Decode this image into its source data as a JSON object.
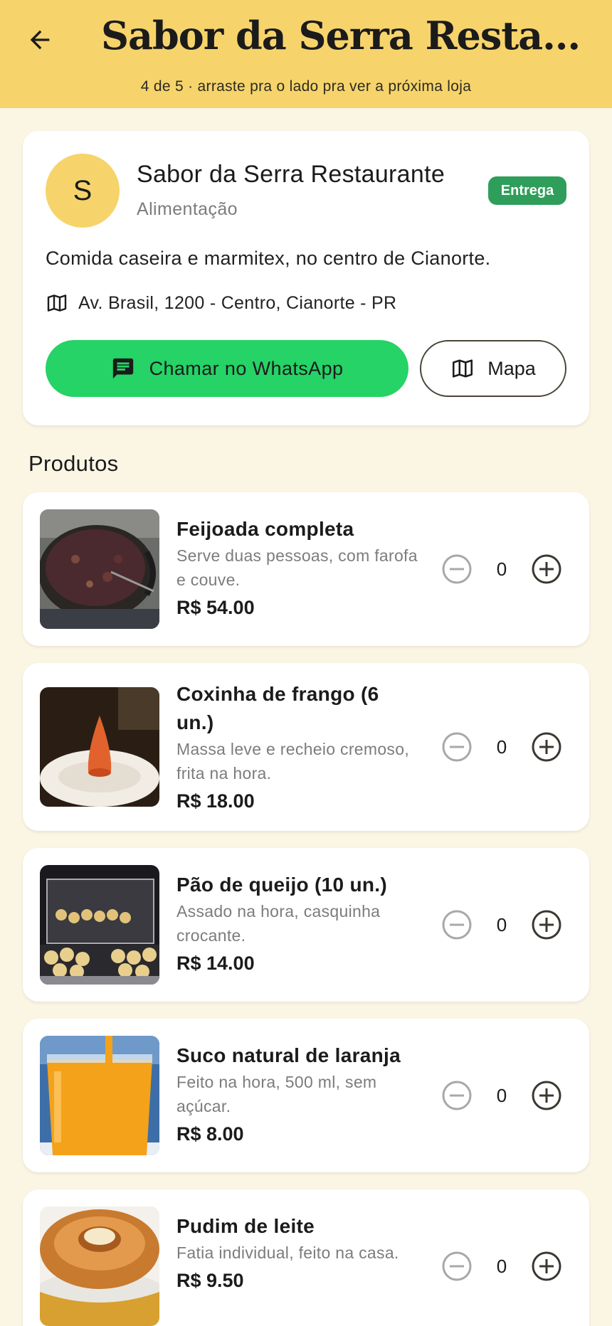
{
  "header": {
    "title": "Sabor da Serra Restaur…",
    "subtitle": "4 de 5 · arraste pra o lado pra ver a próxima loja",
    "back_icon": "arrow-left-icon"
  },
  "store": {
    "avatar_letter": "S",
    "name": "Sabor da Serra Restaurante",
    "category": "Alimentação",
    "badge": "Entrega",
    "description": "Comida caseira e marmitex, no centro de Cianorte.",
    "address": "Av. Brasil, 1200 - Centro, Cianorte - PR",
    "whatsapp_label": "Chamar no WhatsApp",
    "map_label": "Mapa"
  },
  "products_title": "Produtos",
  "products": [
    {
      "name": "Feijoada completa",
      "description": "Serve duas pessoas, com farofa e couve.",
      "price": "R$ 54.00",
      "quantity": "0",
      "image": "feijoada-pot"
    },
    {
      "name": "Coxinha de frango (6 un.)",
      "description": "Massa leve e recheio cremoso, frita na hora.",
      "price": "R$ 18.00",
      "quantity": "0",
      "image": "coxinha-plate"
    },
    {
      "name": "Pão de queijo (10 un.)",
      "description": "Assado na hora, casquinha crocante.",
      "price": "R$ 14.00",
      "quantity": "0",
      "image": "pao-de-queijo-trays"
    },
    {
      "name": "Suco natural de laranja",
      "description": "Feito na hora, 500 ml, sem açúcar.",
      "price": "R$ 8.00",
      "quantity": "0",
      "image": "orange-juice-glass"
    },
    {
      "name": "Pudim de leite",
      "description": "Fatia individual, feito na casa.",
      "price": "R$ 9.50",
      "quantity": "0",
      "image": "pudim-dish"
    }
  ],
  "colors": {
    "header_bg": "#f6d46b",
    "page_bg": "#fbf5e4",
    "badge_bg": "#2e9e5a",
    "whatsapp_bg": "#25d366"
  }
}
